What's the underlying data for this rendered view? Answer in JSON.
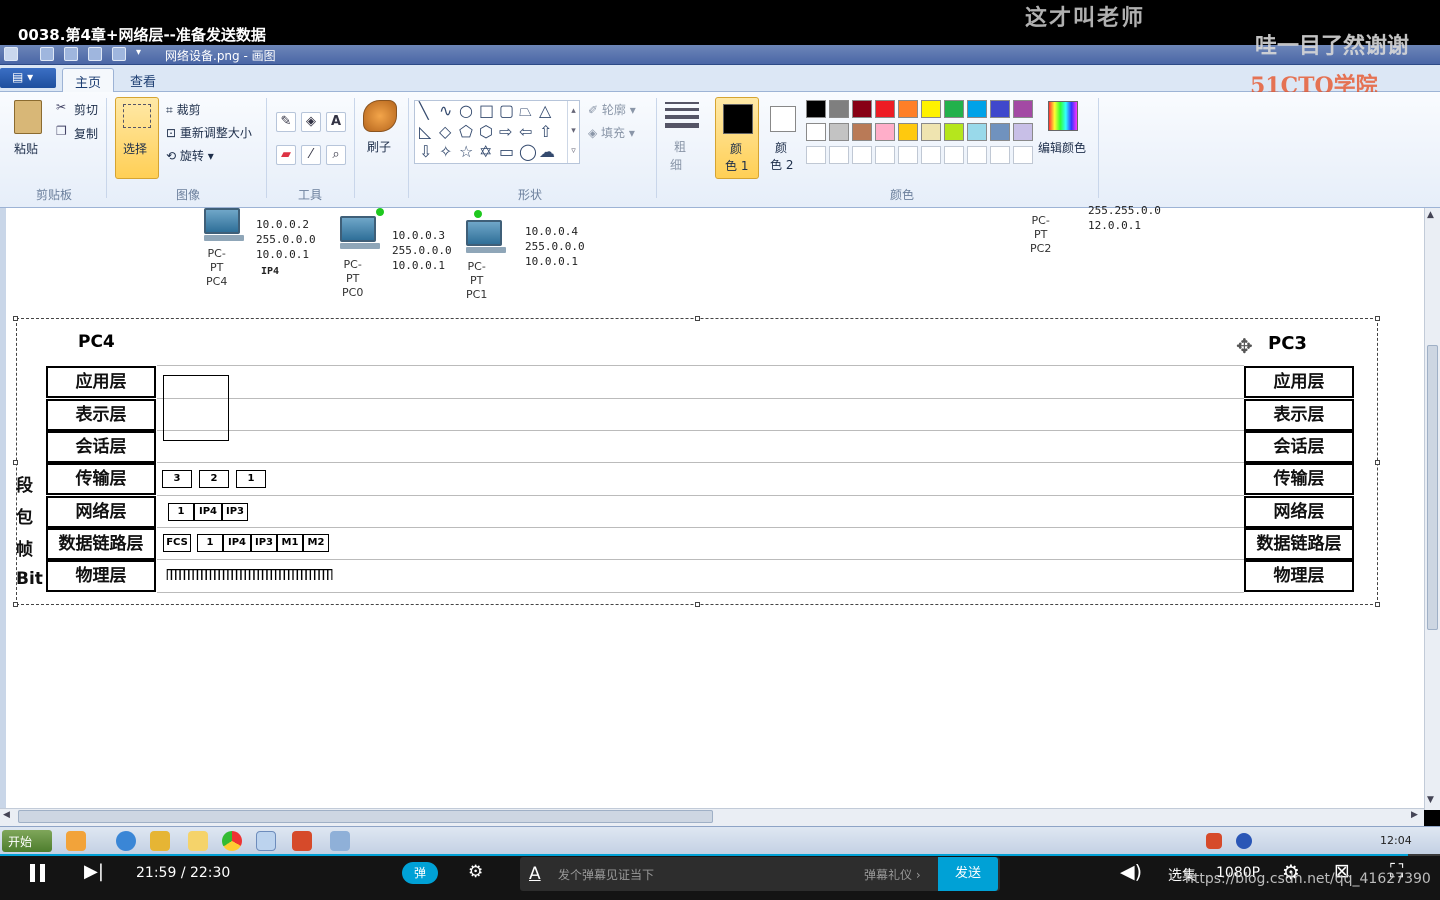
{
  "video": {
    "title": "0038.第4章+网络层--准备发送数据",
    "watermark_top": "这才叫老师",
    "watermark_right": "哇一目了然谢谢",
    "watermark_logo": "51CTO学院",
    "watermark_url": "https://blog.csdn.net/qq_41627390",
    "current_time": "21:59",
    "separator": "/",
    "duration": "22:30",
    "progress": 0.978,
    "danmu_toggle": "弹",
    "danmu_placeholder": "发个弹幕见证当下",
    "danmu_gift": "弹幕礼仪 ›",
    "send_label": "发送",
    "select_label": "选集",
    "quality_label": "1080P",
    "accent": "#00a1d6"
  },
  "paint": {
    "window_title": "网络设备.png - 画图",
    "file_menu": "▤ ▾",
    "tabs": [
      "主页",
      "查看"
    ],
    "clipboard": {
      "paste": "粘贴",
      "cut": "剪切",
      "copy": "复制",
      "label": "剪贴板"
    },
    "image": {
      "select": "选择",
      "crop": "裁剪",
      "resize": "重新调整大小",
      "rotate": "旋转",
      "label": "图像"
    },
    "tools": {
      "label": "工具",
      "brush": "刷子"
    },
    "shapes": {
      "label": "形状",
      "outline": "轮廓",
      "fill": "填充",
      "size_top": "粗",
      "size_bottom": "细"
    },
    "colors": {
      "color1_top": "颜",
      "color1_bottom": "色 1",
      "color2_top": "颜",
      "color2_bottom": "色 2",
      "edit": "编辑颜色",
      "label": "颜色",
      "palette_row1": [
        "#000000",
        "#7f7f7f",
        "#880015",
        "#ed1c24",
        "#ff7f27",
        "#fff200",
        "#22b14c",
        "#00a2e8",
        "#3f48cc",
        "#a349a4"
      ],
      "palette_row2": [
        "#ffffff",
        "#c3c3c3",
        "#b97a57",
        "#ffaec9",
        "#ffc90e",
        "#efe4b0",
        "#b5e61d",
        "#99d9ea",
        "#7092be",
        "#c8bfe7"
      ]
    }
  },
  "network": {
    "pcs": [
      {
        "type": "PC-PT",
        "name": "PC4",
        "ip": "10.0.0.2",
        "mask": "255.0.0.0",
        "gw": "10.0.0.1",
        "tag": "IP4"
      },
      {
        "type": "PC-PT",
        "name": "PC0",
        "ip": "10.0.0.3",
        "mask": "255.0.0.0",
        "gw": "10.0.0.1"
      },
      {
        "type": "PC-PT",
        "name": "PC1",
        "ip": "10.0.0.4",
        "mask": "255.0.0.0",
        "gw": "10.0.0.1"
      },
      {
        "type": "PC-PT",
        "name": "PC2",
        "mask": "255.255.0.0",
        "gw": "12.0.0.1"
      }
    ]
  },
  "diagram": {
    "left_title": "PC4",
    "right_title": "PC3",
    "layers": [
      "应用层",
      "表示层",
      "会话层",
      "传输层",
      "网络层",
      "数据链路层",
      "物理层"
    ],
    "side_labels": [
      "段",
      "包",
      "帧",
      "Bit"
    ],
    "transport_segments": [
      "3",
      "2",
      "1"
    ],
    "network_packet": [
      "1",
      "IP4",
      "IP3"
    ],
    "frame": [
      "FCS",
      "1",
      "IP4",
      "IP3",
      "M1",
      "M2"
    ],
    "bits": "ΠΠΠΠΠΠΠΠΠΠΠΠΠΠΠΠΠΠΠΠΠΠΠΠΠΠΠΠΠΠΠΠΠΠΠΠΠΠ"
  },
  "taskbar": {
    "start": "开始",
    "clock": "12:04"
  }
}
